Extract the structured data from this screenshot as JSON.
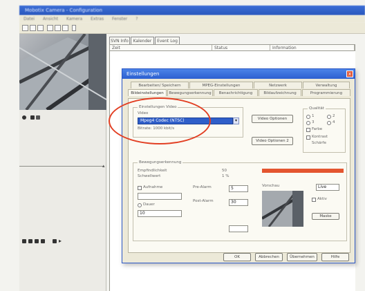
{
  "app": {
    "title": "Mobotix Camera - Configuration",
    "menu": [
      "Datei",
      "Ansicht",
      "Kamera",
      "Extras",
      "Fenster",
      "?"
    ]
  },
  "list_panel": {
    "tabs": [
      "SVN Info",
      "Kalender",
      "Event Log"
    ],
    "columns": [
      "Zeit",
      "Status",
      "Information"
    ]
  },
  "dialog": {
    "title": "Einstellungen",
    "close": "x",
    "tabs_row1": [
      "Bearbeiten/ Speichern",
      "MPEG-Einstellungen",
      "Netzwerk",
      "Verwaltung"
    ],
    "tabs_row2": [
      "Bildeinstellungen",
      "Bewegungserkennung",
      "Benachrichtigung",
      "Bildaufzeichnung",
      "Programmierung"
    ],
    "codec_group": {
      "title": "Einstellungen Video",
      "label": "Video",
      "selected_codec": "Mpeg4 Codec (NTSC)",
      "note": "Bitrate: 1000 kbit/s"
    },
    "buttons_right": {
      "video_options": "Video Optionen",
      "video_options_2": "Video Optionen 2"
    },
    "quality_group": {
      "title": "Qualität",
      "options": [
        "1",
        "2",
        "3",
        "4"
      ],
      "checkboxes": [
        "Farbe",
        "Kontrast",
        "Schärfe"
      ]
    },
    "motion_group": {
      "title": "Bewegungserkennung",
      "field1_label": "Empfindlichkeit",
      "field1_value": "50",
      "field2_label": "Schwellwert",
      "field2_value": "1 %",
      "preview_label": "Vorschau",
      "dropdown_value": "Live",
      "check_label": "Aktiv",
      "button_label": "Maske",
      "left_check_label": "Aufnahme",
      "left_radio_label": "Dauer",
      "left_value": "10",
      "field3_label": "Pre-Alarm",
      "field3_value": "5",
      "field4_label": "Post-Alarm",
      "field4_value": "30"
    },
    "footer_buttons": {
      "ok": "OK",
      "cancel": "Abbrechen",
      "apply": "Übernehmen",
      "help": "Hilfe"
    }
  },
  "colors": {
    "titlebar": "#2a57bd",
    "dialog_title": "#3a70de",
    "selection": "#2f5ec9",
    "motion_bar": "#e4552f",
    "highlight_ellipse": "#e23e22"
  }
}
